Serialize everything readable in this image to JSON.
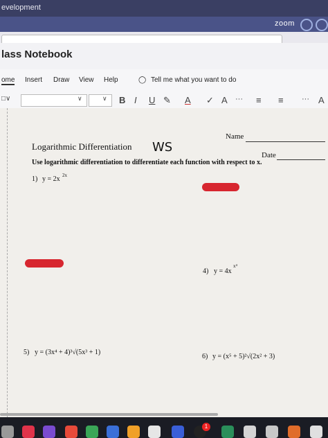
{
  "browser": {
    "title_fragment": "evelopment"
  },
  "zoom": {
    "label": "zoom"
  },
  "app": {
    "notebook_title": "lass Notebook"
  },
  "ribbon": {
    "tabs": [
      "ome",
      "Insert",
      "Draw",
      "View",
      "Help"
    ],
    "tell_me": "Tell me what you want to do"
  },
  "format": {
    "bold": "B",
    "italic": "I",
    "underline": "U",
    "more": "···"
  },
  "worksheet": {
    "name_label": "Name",
    "date_label": "Date",
    "title": "Logarithmic Differentiation",
    "handwritten": "WS",
    "instructions": "Use logarithmic differentiation to differentiate each function with respect to x.",
    "problems": [
      {
        "num": "1)",
        "expr": "y = 2x",
        "sup": "2x"
      },
      {
        "num": "4)",
        "expr": "y = 4x",
        "sup": "x⁴"
      },
      {
        "num": "5)",
        "expr": "y = (3x⁴ + 4)³√(5x³ + 1)"
      },
      {
        "num": "6)",
        "expr": "y = (x⁵ + 5)²√(2x² + 3)"
      }
    ]
  },
  "dock": {
    "badge": "1"
  }
}
